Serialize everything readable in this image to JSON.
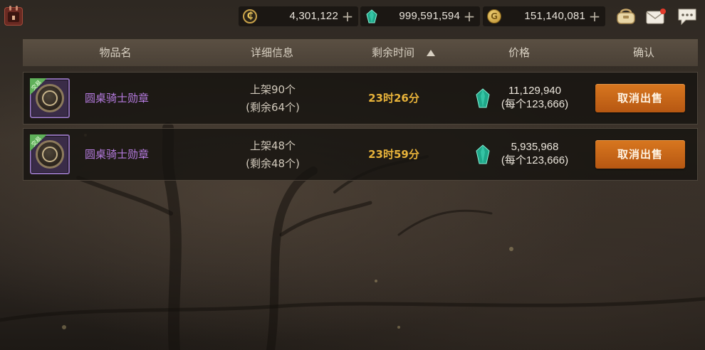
{
  "topbar": {
    "currencies": [
      {
        "icon": "c-coin-icon",
        "amount": "4,301,122",
        "plus": "+"
      },
      {
        "icon": "gem-icon",
        "amount": "999,591,594",
        "plus": "+"
      },
      {
        "icon": "gold-coin-icon",
        "amount": "151,140,081",
        "plus": "+"
      }
    ],
    "icons": [
      "calendar-icon",
      "bag-icon",
      "mail-icon",
      "chat-icon"
    ],
    "mail_has_notification": true
  },
  "table": {
    "headers": {
      "name": "物品名",
      "detail": "详细信息",
      "time": "剩余时间",
      "price": "价格",
      "confirm": "确认"
    },
    "sort": {
      "column": "time",
      "direction": "ascending"
    },
    "rows": [
      {
        "item_name": "圆桌骑士勋章",
        "item_badge": "交易",
        "listed": "上架90个",
        "remaining": "(剩余64个)",
        "time_left": "23时26分",
        "price_total": "11,129,940",
        "price_unit": "(每个123,666)",
        "action": "取消出售"
      },
      {
        "item_name": "圆桌骑士勋章",
        "item_badge": "交易",
        "listed": "上架48个",
        "remaining": "(剩余48个)",
        "time_left": "23时59分",
        "price_total": "5,935,968",
        "price_unit": "(每个123,666)",
        "action": "取消出售"
      }
    ]
  },
  "colors": {
    "item_name": "#b57bdf",
    "time_left": "#e8b33a",
    "button": "#c7661a",
    "header_bg": "#5c5043"
  }
}
